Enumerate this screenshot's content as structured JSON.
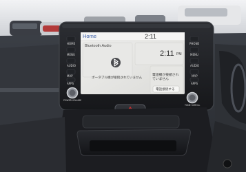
{
  "screen": {
    "header_title": "Home",
    "header_time": "2:11",
    "source_label": "Bluetooth Audio",
    "source_icon": "bluetooth-icon",
    "clock_time": "2:11",
    "clock_suffix": "PM",
    "message": "ポータブル機が接続されていません",
    "notice_text": "電話機が接続されていません",
    "notice_button": "電話接続する"
  },
  "hardware": {
    "left_buttons": [
      "HOME",
      "MENU",
      "AUDIO",
      "MAP",
      "APPS"
    ],
    "right_buttons": [
      "PHONE",
      "MENU",
      "AUDIO",
      "MAP",
      "APPS"
    ],
    "left_knob_label": "POWER VOLUME",
    "right_knob_label": "TUNE SCROLL"
  }
}
